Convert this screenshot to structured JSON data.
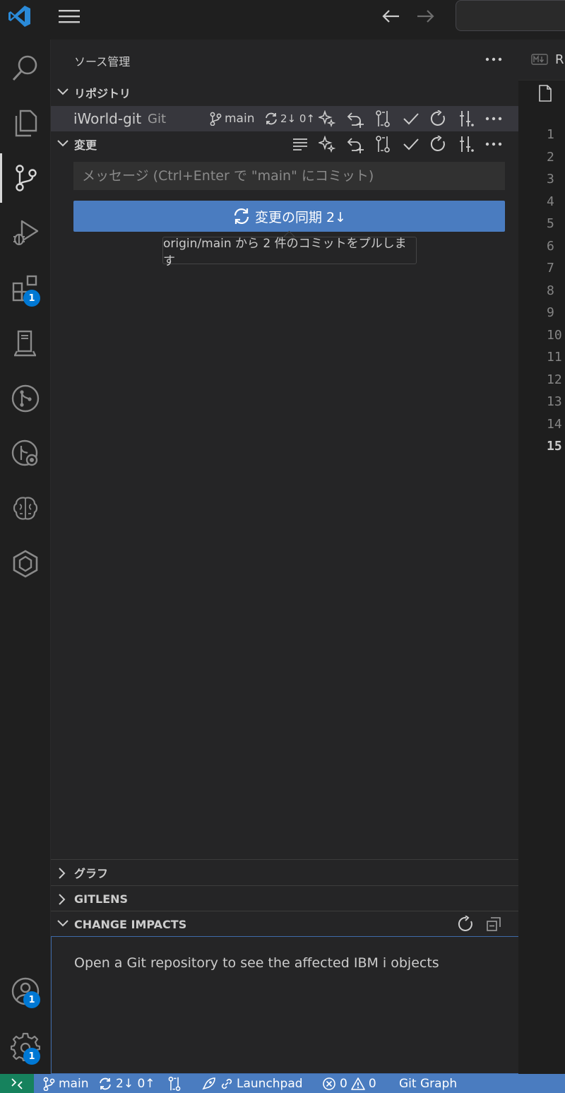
{
  "title_bar": {
    "menu_icon": "menu-icon",
    "back_icon": "arrow-left-icon",
    "forward_icon": "arrow-right-icon"
  },
  "activity_bar": {
    "items": [
      {
        "name": "search",
        "icon": "search-icon"
      },
      {
        "name": "explorer",
        "icon": "files-icon"
      },
      {
        "name": "source-control",
        "icon": "source-control-icon",
        "active": true
      },
      {
        "name": "run-debug",
        "icon": "run-debug-icon"
      },
      {
        "name": "extensions",
        "icon": "extensions-icon",
        "badge": "1"
      },
      {
        "name": "ibm-i",
        "icon": "server-icon"
      },
      {
        "name": "git-graph",
        "icon": "git-graph-icon"
      },
      {
        "name": "gitlens-inspect",
        "icon": "git-inspect-icon"
      },
      {
        "name": "brain",
        "icon": "brain-icon"
      },
      {
        "name": "hexagon",
        "icon": "hexagon-icon"
      }
    ],
    "accounts_badge": "1",
    "settings_badge": "1"
  },
  "sidebar": {
    "title": "ソース管理",
    "repositories": {
      "header": "リポジトリ",
      "repo_name": "iWorld-git",
      "repo_type": "Git",
      "branch": "main",
      "sync_status": "2↓ 0↑"
    },
    "changes": {
      "header": "変更",
      "commit_placeholder": "メッセージ (Ctrl+Enter で \"main\" にコミット)",
      "sync_button_label": "変更の同期 2↓",
      "tooltip": "origin/main から 2 件のコミットをプルします"
    },
    "sections": {
      "graph": "グラフ",
      "gitlens": "GITLENS",
      "change_impacts": "CHANGE IMPACTS"
    },
    "change_impacts_message": "Open a Git repository to see the affected IBM i objects"
  },
  "editor": {
    "tab_label": "R",
    "line_numbers": [
      "1",
      "2",
      "3",
      "4",
      "5",
      "6",
      "7",
      "8",
      "9",
      "10",
      "11",
      "12",
      "13",
      "14",
      "15"
    ],
    "current_line": "15"
  },
  "status_bar": {
    "branch": "main",
    "sync": "2↓ 0↑",
    "launchpad": "Launchpad",
    "errors": "0",
    "warnings": "0",
    "git_graph": "Git Graph"
  },
  "colors": {
    "accent": "#4a7cc0",
    "badge": "#0078d4",
    "remote": "#16825d"
  }
}
